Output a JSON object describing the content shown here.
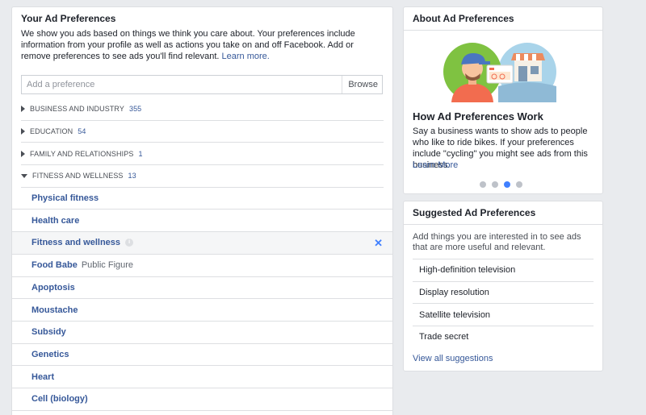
{
  "left": {
    "title": "Your Ad Preferences",
    "intro": "We show you ads based on things we think you care about. Your preferences include information from your profile as well as actions you take on and off Facebook. Add or remove preferences to see ads you'll find relevant.",
    "learn_more": "Learn more.",
    "search_placeholder": "Add a preference",
    "browse_label": "Browse",
    "categories": [
      {
        "label": "Business and industry",
        "count": "355",
        "expanded": false
      },
      {
        "label": "Education",
        "count": "54",
        "expanded": false
      },
      {
        "label": "Family and relationships",
        "count": "1",
        "expanded": false
      },
      {
        "label": "Fitness and wellness",
        "count": "13",
        "expanded": true
      }
    ],
    "items": [
      {
        "label": "Physical fitness",
        "sub": ""
      },
      {
        "label": "Health care",
        "sub": ""
      },
      {
        "label": "Fitness and wellness",
        "sub": ""
      },
      {
        "label": "Food Babe",
        "sub": "Public Figure"
      },
      {
        "label": "Apoptosis",
        "sub": ""
      },
      {
        "label": "Moustache",
        "sub": ""
      },
      {
        "label": "Subsidy",
        "sub": ""
      },
      {
        "label": "Genetics",
        "sub": ""
      },
      {
        "label": "Heart",
        "sub": ""
      },
      {
        "label": "Cell (biology)",
        "sub": ""
      }
    ],
    "info_glyph": "i",
    "remove_glyph": "✕"
  },
  "about": {
    "title": "About Ad Preferences",
    "heading": "How Ad Preferences Work",
    "description": "Say a business wants to show ads to people who like to ride bikes. If your preferences include \"cycling\" you might see ads from this business.",
    "learn_more": "Learn More",
    "active_slide": 3,
    "slide_count": 4
  },
  "suggest": {
    "title": "Suggested Ad Preferences",
    "intro": "Add things you are interested in to see ads that are more useful and relevant.",
    "items": [
      "High-definition television",
      "Display resolution",
      "Satellite television",
      "Trade secret"
    ],
    "view_all": "View all suggestions"
  },
  "colors": {
    "link": "#365899",
    "accent": "#4080ff",
    "background": "#e9ebee"
  }
}
